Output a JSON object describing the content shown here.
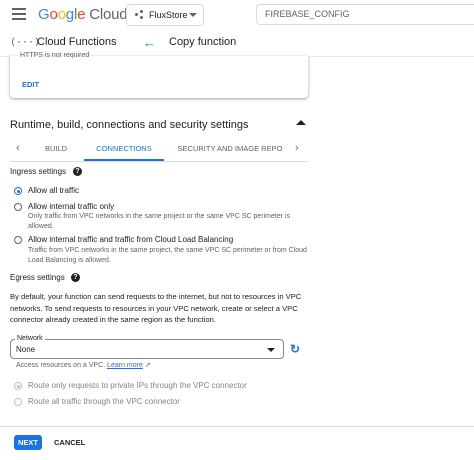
{
  "header": {
    "logo_parts": [
      "G",
      "o",
      "o",
      "g",
      "l",
      "e"
    ],
    "logo_cloud": "Cloud",
    "project_name": "FluxStore",
    "search_value": "FIREBASE_CONFIG"
  },
  "subheader": {
    "service_icon": "(···)",
    "service_title": "Cloud Functions",
    "back_icon": "←",
    "page_title": "Copy function"
  },
  "card": {
    "truncated_text": "HTTPS is not required",
    "edit_label": "EDIT"
  },
  "section": {
    "title": "Runtime, build, connections and security settings"
  },
  "tabs": {
    "prev": "‹",
    "next": "›",
    "items": [
      {
        "label": "BUILD"
      },
      {
        "label": "CONNECTIONS"
      },
      {
        "label": "SECURITY AND IMAGE REPO"
      }
    ],
    "active": "CONNECTIONS"
  },
  "ingress": {
    "title": "Ingress settings",
    "help": "?",
    "options": [
      {
        "label": "Allow all traffic",
        "desc": ""
      },
      {
        "label": "Allow internal traffic only",
        "desc": "Only traffic from VPC networks in the same project or the same VPC SC perimeter is allowed."
      },
      {
        "label": "Allow internal traffic and traffic from Cloud Load Balancing",
        "desc": "Traffic from VPC networks in the same project, the same VPC SC perimeter or from Cloud Load Balancing is allowed."
      }
    ],
    "selected": "Allow all traffic"
  },
  "egress": {
    "title": "Egress settings",
    "help": "?",
    "description": "By default, your function can send requests to the internet, but not to resources in VPC networks. To send requests to resources in your VPC network, create or select a VPC connector already created in the same region as the function.",
    "network_label": "Network",
    "network_value": "None",
    "hint_text": "Access resources on a VPC.",
    "learn_more": "Learn more",
    "routing_options": [
      {
        "label": "Route only requests to private IPs through the VPC connector"
      },
      {
        "label": "Route all traffic through the VPC connector"
      }
    ]
  },
  "footer": {
    "next_label": "NEXT",
    "cancel_label": "CANCEL"
  },
  "colors": {
    "accent": "#1a73e8",
    "text": "#202124",
    "muted": "#5f6368"
  }
}
